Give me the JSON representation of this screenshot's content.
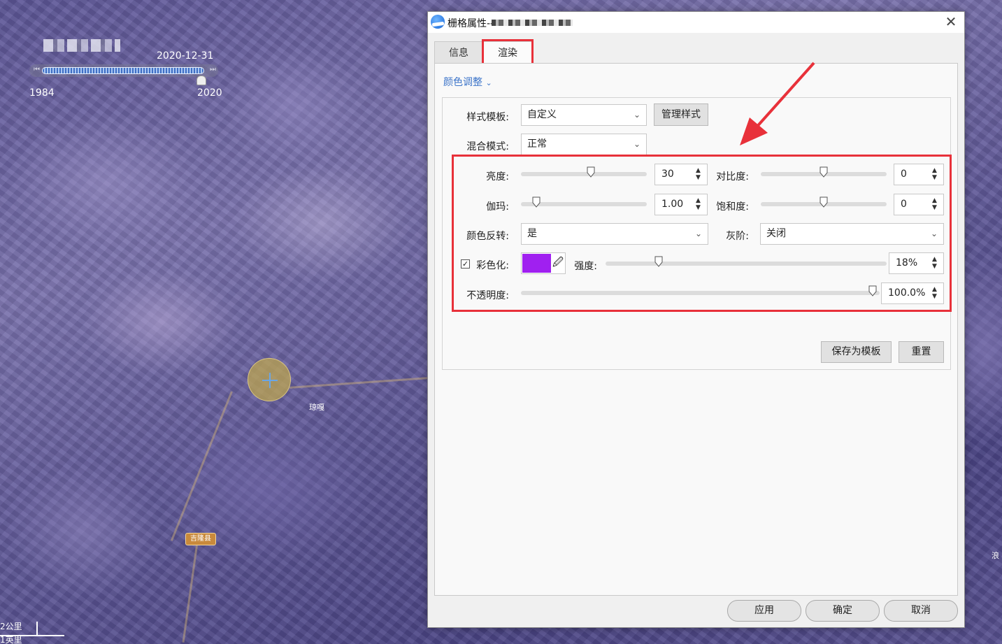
{
  "map": {
    "timeline": {
      "date": "2020-12-31",
      "min_year": "1984",
      "max_year": "2020"
    },
    "labels": {
      "place1": "琼嘎",
      "town_badge": "吉隆县",
      "right_edge": "浪"
    },
    "scale": {
      "km": "2公里",
      "mi": "1英里"
    }
  },
  "dialog": {
    "title": "栅格属性--",
    "close": "✕",
    "tabs": {
      "info": "信息",
      "render": "渲染"
    },
    "section": {
      "label": "颜色调整",
      "chevron": "⌄"
    },
    "style_template": {
      "label": "样式模板:",
      "value": "自定义",
      "manage_btn": "管理样式"
    },
    "blend_mode": {
      "label": "混合模式:",
      "value": "正常"
    },
    "brightness": {
      "label": "亮度:",
      "value": "30"
    },
    "contrast": {
      "label": "对比度:",
      "value": "0"
    },
    "gamma": {
      "label": "伽玛:",
      "value": "1.00"
    },
    "saturation": {
      "label": "饱和度:",
      "value": "0"
    },
    "invert": {
      "label": "颜色反转:",
      "value": "是"
    },
    "grayscale": {
      "label": "灰阶:",
      "value": "关闭"
    },
    "colorize": {
      "label": "彩色化:",
      "checked": "☑",
      "check_mark": "✓",
      "color": "#a020f0",
      "picker_icon": "🖉"
    },
    "intensity": {
      "label": "强度:",
      "value": "18%"
    },
    "opacity": {
      "label": "不透明度:",
      "value": "100.0%"
    },
    "save_template_btn": "保存为模板",
    "reset_btn": "重置",
    "footer": {
      "apply": "应用",
      "ok": "确定",
      "cancel": "取消"
    },
    "highlight_color": "#e8313a",
    "accent_color": "#3a73c9"
  }
}
